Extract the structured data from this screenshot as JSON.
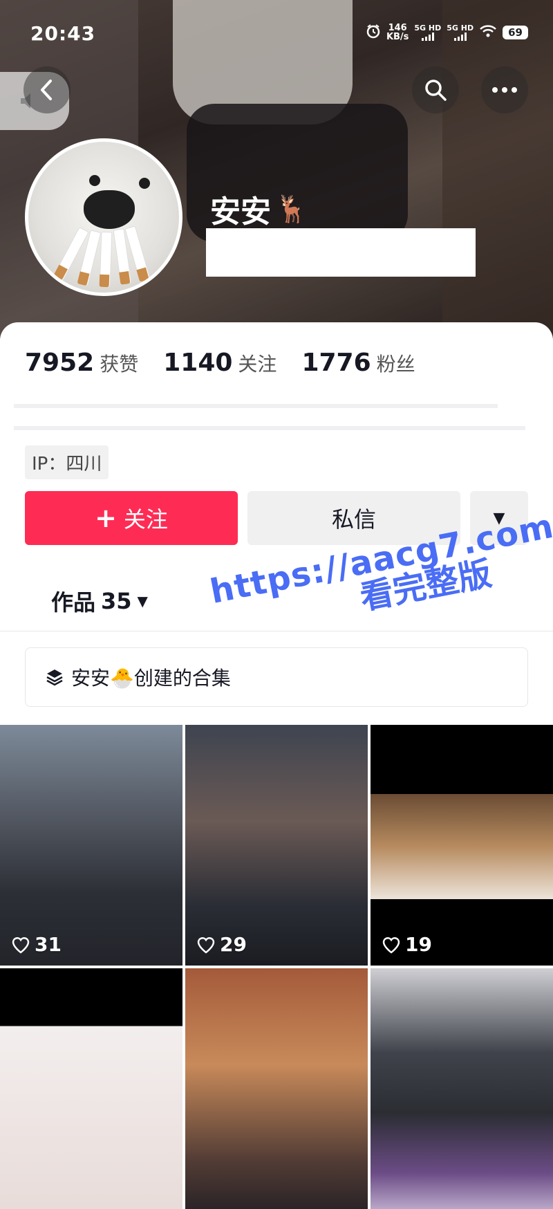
{
  "status_bar": {
    "time": "20:43",
    "speed_value": "146",
    "speed_unit": "KB/s",
    "signal1": "5G HD",
    "signal2": "5G HD",
    "battery": "69"
  },
  "profile": {
    "name": "安安",
    "name_emoji": "🦌",
    "stats": [
      {
        "num": "7952",
        "label": "获赞"
      },
      {
        "num": "1140",
        "label": "关注"
      },
      {
        "num": "1776",
        "label": "粉丝"
      }
    ],
    "ip": "IP：四川"
  },
  "actions": {
    "follow_label": "关注",
    "follow_icon": "+",
    "message_label": "私信",
    "more_icon": "▼"
  },
  "tab": {
    "label": "作品",
    "count": "35",
    "caret": "▼"
  },
  "collection": {
    "prefix": "安安",
    "emoji": "🐣",
    "suffix": "创建的合集"
  },
  "watermark": {
    "line1": "https://aacg7.com",
    "line2": "看完整版"
  },
  "videos": [
    {
      "likes": "31"
    },
    {
      "likes": "29"
    },
    {
      "likes": "19"
    },
    {
      "likes": ""
    },
    {
      "likes": ""
    },
    {
      "likes": ""
    }
  ],
  "colors": {
    "accent": "#fe2c55",
    "watermark": "#4a6df5"
  }
}
